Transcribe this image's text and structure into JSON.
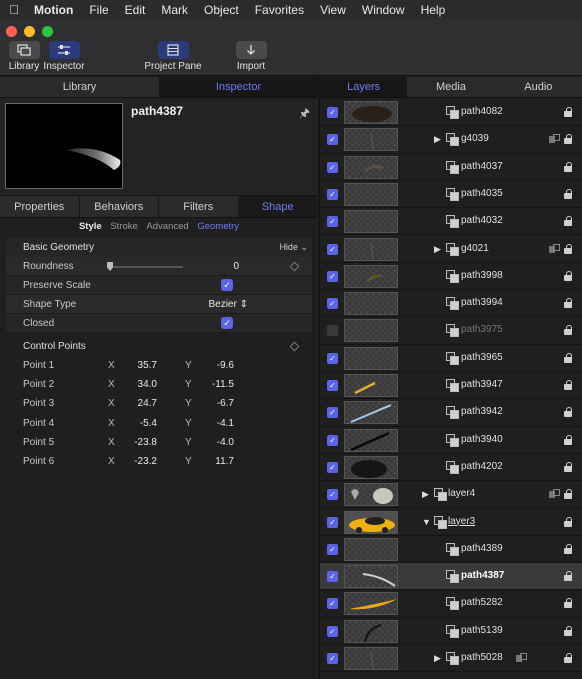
{
  "menubar": {
    "app": "Motion",
    "menus": [
      "File",
      "Edit",
      "Mark",
      "Object",
      "Favorites",
      "View",
      "Window",
      "Help"
    ]
  },
  "toolbar": {
    "library": "Library",
    "inspector": "Inspector",
    "project_pane": "Project Pane",
    "import": "Import"
  },
  "left_tabs": {
    "library": "Library",
    "inspector": "Inspector"
  },
  "inspector": {
    "object_name": "path4387",
    "subtabs": [
      "Properties",
      "Behaviors",
      "Filters",
      "Shape"
    ],
    "shape_segments": [
      "Style",
      "Stroke",
      "Advanced",
      "Geometry"
    ],
    "basic_geometry": {
      "title": "Basic Geometry",
      "hide": "Hide",
      "roundness_label": "Roundness",
      "roundness_value": "0",
      "roundness_fraction": 0,
      "preserve_scale_label": "Preserve Scale",
      "preserve_scale_checked": true,
      "shape_type_label": "Shape Type",
      "shape_type_value": "Bezier",
      "closed_label": "Closed",
      "closed_checked": true
    },
    "control_points": {
      "title": "Control Points",
      "x_label": "X",
      "y_label": "Y",
      "points": [
        {
          "label": "Point 1",
          "x": "35.7",
          "y": "-9.6"
        },
        {
          "label": "Point 2",
          "x": "34.0",
          "y": "-11.5"
        },
        {
          "label": "Point 3",
          "x": "24.7",
          "y": "-6.7"
        },
        {
          "label": "Point 4",
          "x": "-5.4",
          "y": "-4.1"
        },
        {
          "label": "Point 5",
          "x": "-23.8",
          "y": "-4.0"
        },
        {
          "label": "Point 6",
          "x": "-23.2",
          "y": "11.7"
        }
      ]
    }
  },
  "right_tabs": {
    "layers": "Layers",
    "media": "Media",
    "audio": "Audio"
  },
  "layers": [
    {
      "name": "path4082",
      "checked": true,
      "group": false,
      "thumb": "dark-blob"
    },
    {
      "name": "g4039",
      "checked": true,
      "group": true,
      "thumb": "faint-line"
    },
    {
      "name": "path4037",
      "checked": true,
      "group": false,
      "thumb": "faint-shape"
    },
    {
      "name": "path4035",
      "checked": true,
      "group": false,
      "thumb": "empty"
    },
    {
      "name": "path4032",
      "checked": true,
      "group": false,
      "thumb": "empty"
    },
    {
      "name": "g4021",
      "checked": true,
      "group": true,
      "thumb": "faint-line"
    },
    {
      "name": "path3998",
      "checked": true,
      "group": false,
      "thumb": "faint-yellow"
    },
    {
      "name": "path3994",
      "checked": true,
      "group": false,
      "thumb": "empty"
    },
    {
      "name": "path3975",
      "checked": false,
      "group": false,
      "thumb": "empty"
    },
    {
      "name": "path3965",
      "checked": true,
      "group": false,
      "thumb": "empty"
    },
    {
      "name": "path3947",
      "checked": true,
      "group": false,
      "thumb": "yellow-line"
    },
    {
      "name": "path3942",
      "checked": true,
      "group": false,
      "thumb": "blue-line"
    },
    {
      "name": "path3940",
      "checked": true,
      "group": false,
      "thumb": "black-line"
    },
    {
      "name": "path4202",
      "checked": true,
      "group": false,
      "thumb": "dark-oval"
    },
    {
      "name": "layer4",
      "checked": true,
      "group": true,
      "thumb": "pins"
    },
    {
      "name": "layer3",
      "checked": true,
      "group": true,
      "thumb": "car",
      "expanded": true
    },
    {
      "name": "path4389",
      "checked": true,
      "group": false,
      "thumb": "empty"
    },
    {
      "name": "path4387",
      "checked": true,
      "group": false,
      "thumb": "white-curve",
      "selected": true
    },
    {
      "name": "path5282",
      "checked": true,
      "group": false,
      "thumb": "yellow-swoosh"
    },
    {
      "name": "path5139",
      "checked": true,
      "group": false,
      "thumb": "dark-arc"
    },
    {
      "name": "path5028",
      "checked": true,
      "group": true,
      "thumb": "faint-line"
    }
  ],
  "colors": {
    "accent": "#6f7cf5",
    "checkbox": "#5b64e8"
  }
}
